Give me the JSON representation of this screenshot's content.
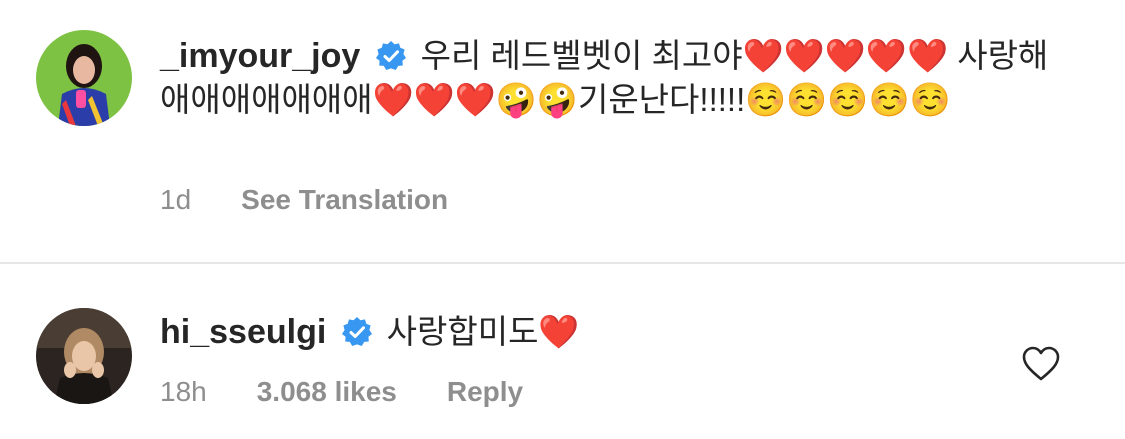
{
  "comments": [
    {
      "username": "_imyour_joy",
      "verified": true,
      "text": "우리 레드벨벳이 최고야❤️❤️❤️❤️❤️ 사랑해애애애애애애애❤️❤️❤️🤪🤪기운난다!!!!!☺️☺️☺️☺️☺️",
      "time": "1d",
      "action": "See Translation",
      "avatar_icon": "profile-photo-joy"
    },
    {
      "username": "hi_sseulgi",
      "verified": true,
      "text": "사랑합미도❤️",
      "time": "18h",
      "likes": "3.068 likes",
      "action": "Reply",
      "avatar_icon": "profile-photo-seulgi",
      "like_icon": "heart-outline-icon"
    }
  ],
  "colors": {
    "text": "#262626",
    "muted": "#8e8e8e",
    "verified_badge": "#3897f0",
    "divider": "#e6e6e6"
  }
}
